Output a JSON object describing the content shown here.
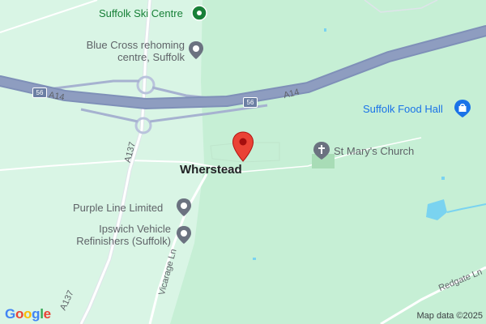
{
  "places": {
    "village": "Wherstead"
  },
  "pois": {
    "ski_centre": "Suffolk Ski Centre",
    "blue_cross_line1": "Blue Cross rehoming",
    "blue_cross_line2": "centre, Suffolk",
    "food_hall": "Suffolk Food Hall",
    "church": "St Mary's Church",
    "purple_line": "Purple Line Limited",
    "ipswich_line1": "Ipswich Vehicle",
    "ipswich_line2": "Refinishers (Suffolk)"
  },
  "roads": {
    "a14_left": "A14",
    "a14_right": "A14",
    "a137_upper": "A137",
    "a137_lower": "A137",
    "vicarage": "Vicarage Ln",
    "redgate": "Redgate Ln",
    "junction_left": "56",
    "junction_right": "56"
  },
  "branding": {
    "google_letters": [
      "G",
      "o",
      "o",
      "g",
      "l",
      "e"
    ],
    "attribution": "Map data ©2025"
  },
  "colors": {
    "land": "#d9f5e5",
    "park": "#c6efd5",
    "motorway": "#8e9dc0",
    "road": "#ffffff",
    "water": "#7ad3f0",
    "marker": "#ea4335",
    "poi_grey": "#5f6368",
    "poi_blue": "#1a73e8",
    "poi_green": "#188038"
  },
  "icons": {
    "ski": "ski-icon",
    "generic_poi": "generic-poi-icon",
    "shop": "shopping-bag-icon",
    "church": "church-cross-icon",
    "marker": "location-pin-icon"
  }
}
